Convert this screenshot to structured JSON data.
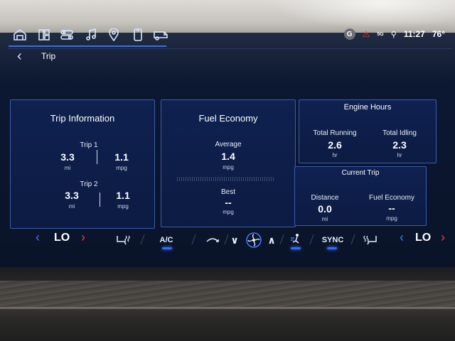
{
  "status_bar": {
    "avatar_letter": "G",
    "network": "5G",
    "time": "11:27",
    "temperature": "76°"
  },
  "nav_icons": [
    "home-icon",
    "apps-grid-icon",
    "controls-icon",
    "music-icon",
    "location-pin-icon",
    "phone-icon",
    "camper-icon"
  ],
  "header": {
    "title": "Trip"
  },
  "trip_info": {
    "title": "Trip Information",
    "trip1": {
      "label": "Trip 1",
      "distance": "3.3",
      "distance_unit": "mi",
      "economy": "1.1",
      "economy_unit": "mpg"
    },
    "trip2": {
      "label": "Trip 2",
      "distance": "3.3",
      "distance_unit": "mi",
      "economy": "1.1",
      "economy_unit": "mpg"
    }
  },
  "fuel_economy": {
    "title": "Fuel Economy",
    "average_label": "Average",
    "average_value": "1.4",
    "average_unit": "mpg",
    "best_label": "Best",
    "best_value": "--",
    "best_unit": "mpg"
  },
  "engine_hours": {
    "title": "Engine Hours",
    "total_running_label": "Total Running",
    "total_running_value": "2.6",
    "total_running_unit": "hr",
    "total_idling_label": "Total Idling",
    "total_idling_value": "2.3",
    "total_idling_unit": "hr"
  },
  "current_trip": {
    "title": "Current Trip",
    "distance_label": "Distance",
    "distance_value": "0.0",
    "distance_unit": "mi",
    "fuel_economy_label": "Fuel Economy",
    "fuel_economy_value": "--",
    "fuel_economy_unit": "mpg"
  },
  "climate": {
    "left_temp": "LO",
    "right_temp": "LO",
    "ac_label": "A/C",
    "sync_label": "SYNC"
  },
  "colors": {
    "accent_blue": "#3f7bff",
    "accent_red": "#ff3a3a",
    "card_border": "#3b5cae",
    "background": "#0b1630"
  }
}
